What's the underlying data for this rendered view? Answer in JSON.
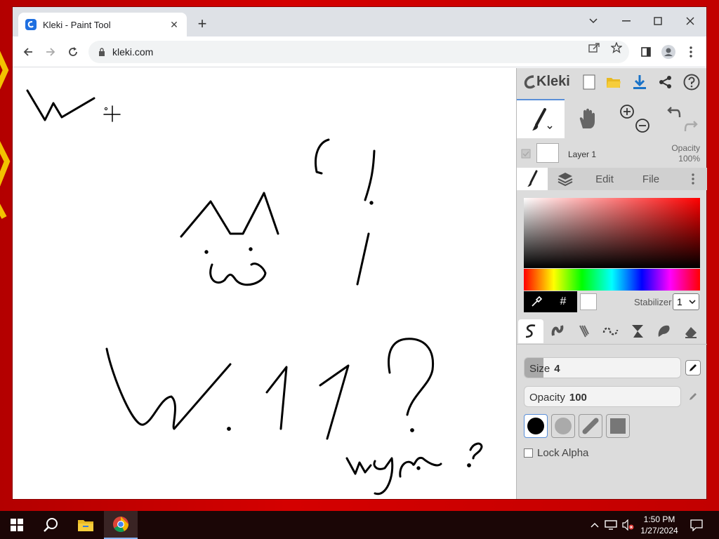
{
  "browser": {
    "tab_title": "Kleki - Paint Tool",
    "url": "kleki.com"
  },
  "app": {
    "brand": "Kleki",
    "layer": {
      "name": "Layer 1",
      "opacity_label": "Opacity",
      "opacity_value": "100%"
    },
    "panel_tabs": [
      "Edit",
      "File"
    ],
    "stabilizer_label": "Stabilizer",
    "stabilizer_value": "1",
    "hex_label": "#",
    "size_label": "Size",
    "size_value": "4",
    "size_level": 0.12,
    "opacity_label": "Opacity",
    "opacity_value": "100",
    "lock_alpha_label": "Lock Alpha",
    "canvas_text": {
      "w11": "W.11?",
      "wym": "wym ?"
    }
  },
  "taskbar": {
    "time": "1:50 PM",
    "date": "1/27/2024"
  }
}
